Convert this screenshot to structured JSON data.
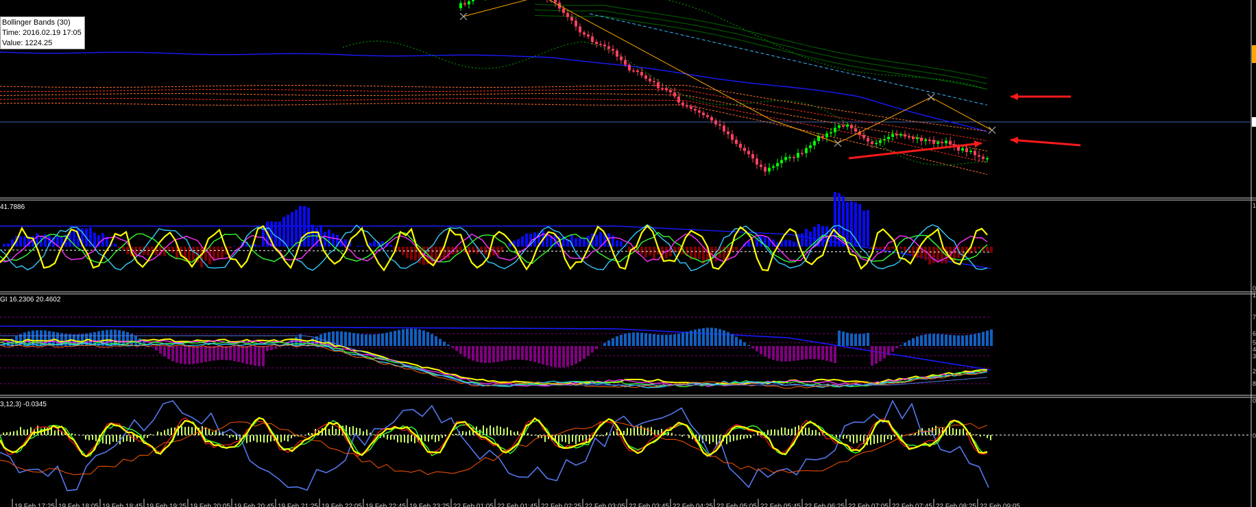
{
  "tooltip": {
    "name": "Bollinger Bands (30)",
    "time": "Time: 2016.02.19 17:05",
    "value": "Value: 1224.25"
  },
  "panes": {
    "p1": {
      "label": "41.7886"
    },
    "p2": {
      "label": "GI 16.2306 20.4602"
    },
    "p3": {
      "label": "3,12,3) -0.0345"
    }
  },
  "time_axis": [
    "19 Feb 17:25",
    "19 Feb 18:05",
    "19 Feb 18:45",
    "19 Feb 19:25",
    "19 Feb 20:05",
    "19 Feb 20:45",
    "19 Feb 21:25",
    "19 Feb 22:05",
    "19 Feb 22:45",
    "19 Feb 23:25",
    "22 Feb 01:05",
    "22 Feb 01:45",
    "22 Feb 02:25",
    "22 Feb 03:05",
    "22 Feb 03:45",
    "22 Feb 04:25",
    "22 Feb 05:05",
    "22 Feb 05:45",
    "22 Feb 06:25",
    "22 Feb 07:05",
    "22 Feb 07:45",
    "22 Feb 08:25",
    "22 Feb 09:05"
  ],
  "right_labels": [
    "1",
    "0",
    "1",
    "7",
    "6",
    "5",
    "4",
    "3",
    "2",
    "8",
    "0",
    "0"
  ],
  "colors": {
    "background": "#000000",
    "bull": "#00ff00",
    "bear": "#ff4060",
    "ma_blue": "#1a1aff",
    "arrow": "#ff1a1a",
    "yellow": "#ffff00",
    "cyan": "#33ccff",
    "magenta": "#ff33ff",
    "green": "#33ff33",
    "hist_blue": "#0a0aff",
    "hist_red": "#800000",
    "hist_navy": "#1060c0",
    "hist_purple": "#800080",
    "hist_lime": "#ccff66",
    "steel": "#5577ee",
    "orange": "#ff5500"
  }
}
